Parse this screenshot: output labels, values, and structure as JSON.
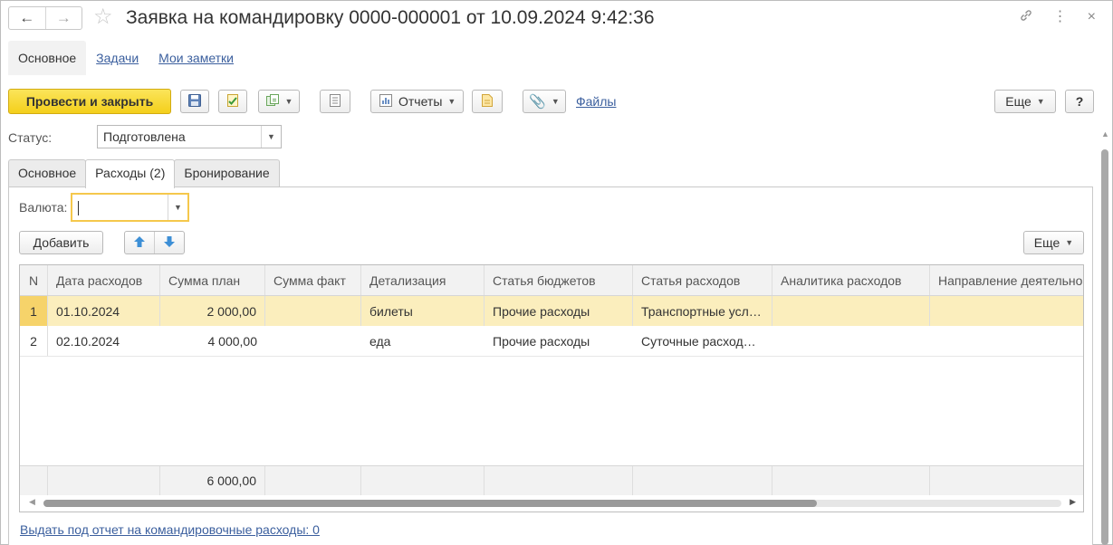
{
  "window": {
    "title": "Заявка на командировку 0000-000001 от 10.09.2024 9:42:36"
  },
  "form_tabs": [
    {
      "label": "Основное",
      "active": true
    },
    {
      "label": "Задачи",
      "active": false
    },
    {
      "label": "Мои заметки",
      "active": false
    }
  ],
  "toolbar": {
    "post_close_label": "Провести и закрыть",
    "reports_label": "Отчеты",
    "files_label": "Файлы",
    "more_label": "Еще",
    "help_label": "?"
  },
  "status": {
    "label": "Статус:",
    "value": "Подготовлена"
  },
  "sub_tabs": [
    {
      "label": "Основное",
      "active": false
    },
    {
      "label": "Расходы (2)",
      "active": true
    },
    {
      "label": "Бронирование",
      "active": false
    }
  ],
  "currency": {
    "label": "Валюта:",
    "value": ""
  },
  "table_toolbar": {
    "add_label": "Добавить",
    "more_label": "Еще"
  },
  "table": {
    "columns": [
      "N",
      "Дата расходов",
      "Сумма план",
      "Сумма факт",
      "Детализация",
      "Статья бюджетов",
      "Статья расходов",
      "Аналитика расходов",
      "Направление деятельности"
    ],
    "rows": [
      {
        "n": "1",
        "date": "01.10.2024",
        "plan": "2 000,00",
        "fact": "",
        "detail": "билеты",
        "budget": "Прочие расходы",
        "expense": "Транспортные усл…",
        "analytics": "",
        "direction": ""
      },
      {
        "n": "2",
        "date": "02.10.2024",
        "plan": "4 000,00",
        "fact": "",
        "detail": "еда",
        "budget": "Прочие расходы",
        "expense": "Суточные расход…",
        "analytics": "",
        "direction": ""
      }
    ],
    "totals": {
      "plan": "6 000,00"
    }
  },
  "footer": {
    "advance_link": "Выдать под отчет на командировочные расходы: 0"
  },
  "colors": {
    "primary_button": "#f4cf1b",
    "selected_row": "#fbeebd",
    "selected_row_marker": "#f6d36a",
    "focus_border": "#f5c84c",
    "link": "#3b5f9e"
  }
}
